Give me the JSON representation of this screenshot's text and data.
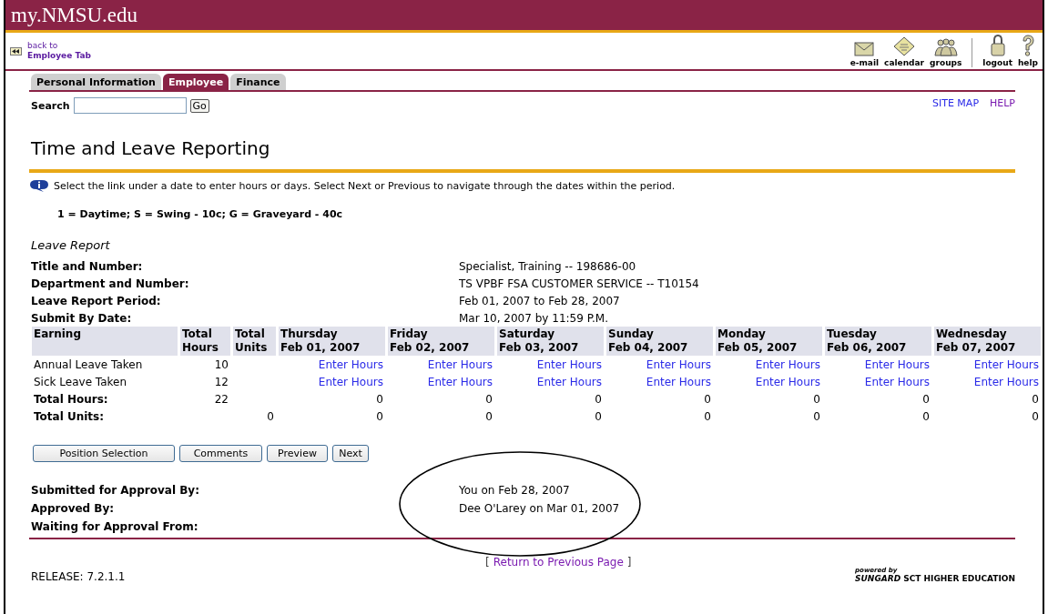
{
  "header": {
    "site_title": "my.NMSU.edu"
  },
  "back_link": {
    "line_1": "back to",
    "line_2": "Employee Tab"
  },
  "toolbar": {
    "main": [
      {
        "kind": "mail",
        "label": "e-mail"
      },
      {
        "kind": "calendar",
        "label": "calendar"
      },
      {
        "kind": "groups",
        "label": "groups"
      }
    ],
    "session": [
      {
        "kind": "logout",
        "label": "logout"
      },
      {
        "kind": "help",
        "label": "help"
      }
    ]
  },
  "tabs": [
    {
      "label": "Personal Information",
      "selected": false
    },
    {
      "label": "Employee",
      "selected": true
    },
    {
      "label": "Finance",
      "selected": false
    }
  ],
  "search": {
    "label": "Search",
    "button": "Go"
  },
  "top_links": [
    {
      "label": "SITE MAP",
      "visited": false
    },
    {
      "label": "HELP",
      "visited": true
    }
  ],
  "page_title": "Time and Leave Reporting",
  "info_text": "Select the link under a date to enter hours or days. Select Next or Previous to navigate through the dates within the period.",
  "legend": "1 = Daytime; S = Swing - 10c; G = Graveyard - 40c",
  "report": {
    "title": "Leave Report",
    "fields": [
      {
        "label": "Title and Number:",
        "value": "Specialist, Training -- 198686-00"
      },
      {
        "label": "Department and Number:",
        "value": "TS VPBF FSA CUSTOMER SERVICE -- T10154"
      },
      {
        "label": "Leave Report Period:",
        "value": "Feb 01, 2007 to Feb 28, 2007"
      },
      {
        "label": "Submit By Date:",
        "value": "Mar 10, 2007 by 11:59 P.M."
      }
    ]
  },
  "table": {
    "columns": [
      {
        "line_1": "Earning"
      },
      {
        "line_1": "Total",
        "line_2": "Hours"
      },
      {
        "line_1": "Total",
        "line_2": "Units"
      },
      {
        "line_1": "Thursday",
        "line_2": "Feb 01, 2007"
      },
      {
        "line_1": "Friday",
        "line_2": "Feb 02, 2007"
      },
      {
        "line_1": "Saturday",
        "line_2": "Feb 03, 2007"
      },
      {
        "line_1": "Sunday",
        "line_2": "Feb 04, 2007"
      },
      {
        "line_1": "Monday",
        "line_2": "Feb 05, 2007"
      },
      {
        "line_1": "Tuesday",
        "line_2": "Feb 06, 2007"
      },
      {
        "line_1": "Wednesday",
        "line_2": "Feb 07, 2007"
      }
    ],
    "rows": [
      {
        "kind": "leave",
        "earning": "Annual Leave Taken",
        "total_hours": "10",
        "days": [
          "Enter Hours",
          "Enter Hours",
          "Enter Hours",
          "Enter Hours",
          "Enter Hours",
          "Enter Hours",
          "Enter Hours"
        ]
      },
      {
        "kind": "leave",
        "earning": "Sick Leave Taken",
        "total_hours": "12",
        "days": [
          "Enter Hours",
          "Enter Hours",
          "Enter Hours",
          "Enter Hours",
          "Enter Hours",
          "Enter Hours",
          "Enter Hours"
        ]
      },
      {
        "kind": "total",
        "earning": "Total Hours:",
        "total_hours": "22",
        "days": [
          "0",
          "0",
          "0",
          "0",
          "0",
          "0",
          "0"
        ]
      },
      {
        "kind": "total",
        "earning": "Total Units:",
        "total_units": "0",
        "days": [
          "0",
          "0",
          "0",
          "0",
          "0",
          "0",
          "0"
        ]
      }
    ]
  },
  "buttons": [
    "Position Selection",
    "Comments",
    "Preview",
    "Next"
  ],
  "approval": [
    {
      "label": "Submitted for Approval By:",
      "value": "You on Feb 28, 2007"
    },
    {
      "label": "Approved By:",
      "value": "Dee O'Larey on Mar 01, 2007"
    },
    {
      "label": "Waiting for Approval From:"
    }
  ],
  "footer": {
    "release": "RELEASE: 7.2.1.1",
    "bracket_open": "[",
    "return_link": "Return to Previous Page",
    "bracket_close": "]",
    "vendor": {
      "tagline": "powered by",
      "name": "SUNGARD",
      "suffix": "SCT HIGHER EDUCATION"
    }
  }
}
